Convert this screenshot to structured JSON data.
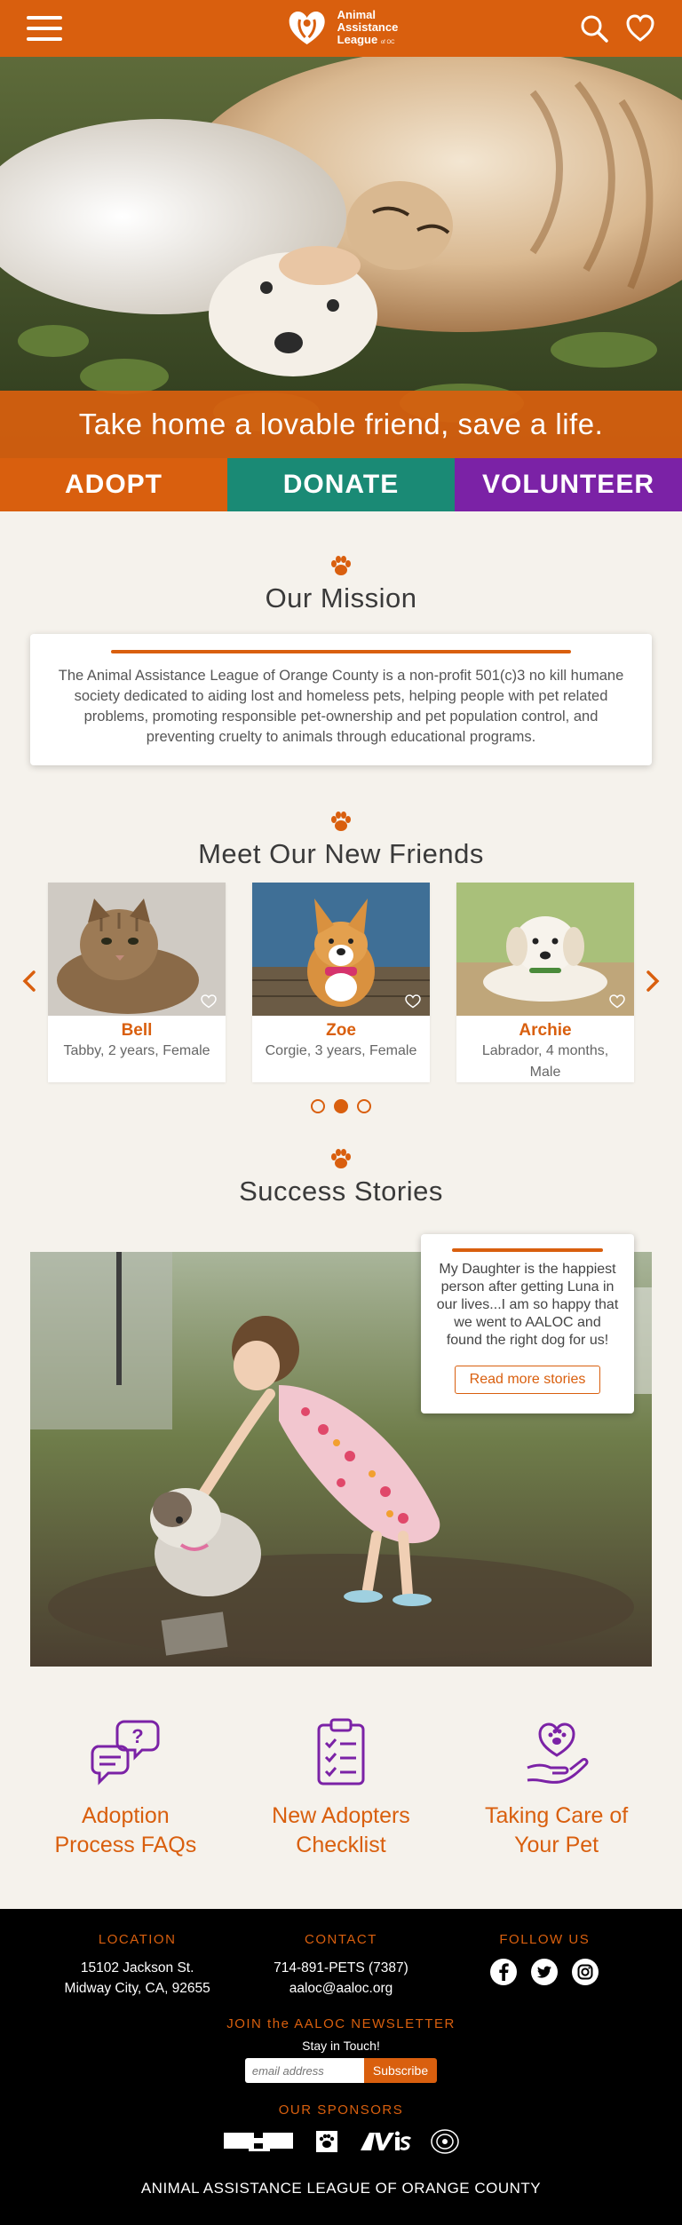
{
  "header": {
    "logo_line1": "Animal",
    "logo_line2": "Assistance",
    "logo_line3": "League",
    "logo_suffix": "of OC",
    "menu_icon": "hamburger-menu-icon",
    "search_icon": "search-icon",
    "favorites_icon": "heart-icon"
  },
  "hero": {
    "headline": "Take home a lovable friend, save a life."
  },
  "cta": {
    "adopt": "ADOPT",
    "donate": "DONATE",
    "volunteer": "VOLUNTEER"
  },
  "mission": {
    "title": "Our Mission",
    "text": "The Animal Assistance League of Orange County is a non-profit 501(c)3 no kill humane society dedicated to aiding lost and homeless pets, helping people with pet related problems, promoting responsible pet-ownership and pet population control, and preventing cruelty to animals through educational programs."
  },
  "friends": {
    "title": "Meet Our New Friends",
    "pets": [
      {
        "name": "Bell",
        "desc": "Tabby, 2 years, Female"
      },
      {
        "name": "Zoe",
        "desc": "Corgie, 3 years, Female"
      },
      {
        "name": "Archie",
        "desc": "Labrador, 4 months, Male"
      }
    ],
    "active_page": 2,
    "page_count": 3
  },
  "stories": {
    "title": "Success Stories",
    "quote": "My Daughter is the happiest person after getting Luna in our lives...I am so happy that we went to AALOC and found the right dog for us!",
    "button": "Read more stories"
  },
  "resources": [
    {
      "label_line1": "Adoption",
      "label_line2": "Process FAQs",
      "icon": "faq-chat-icon"
    },
    {
      "label_line1": "New Adopters",
      "label_line2": "Checklist",
      "icon": "checklist-icon"
    },
    {
      "label_line1": "Taking Care of",
      "label_line2": "Your Pet",
      "icon": "pet-care-hand-icon"
    }
  ],
  "footer": {
    "location_head": "LOCATION",
    "location_line1": "15102 Jackson St.",
    "location_line2": "Midway City, CA, 92655",
    "contact_head": "CONTACT",
    "phone": "714-891-PETS (7387)",
    "email": "aaloc@aaloc.org",
    "follow_head": "FOLLOW US",
    "newsletter_head": "JOIN the AALOC NEWSLETTER",
    "newsletter_sub": "Stay in Touch!",
    "email_placeholder": "email address",
    "subscribe": "Subscribe",
    "sponsors_head": "OUR SPONSORS",
    "bottom": "ANIMAL ASSISTANCE LEAGUE OF ORANGE COUNTY"
  },
  "colors": {
    "brand_orange": "#d95f0e",
    "donate_teal": "#1a8a75",
    "volunteer_purple": "#7b22a6"
  }
}
